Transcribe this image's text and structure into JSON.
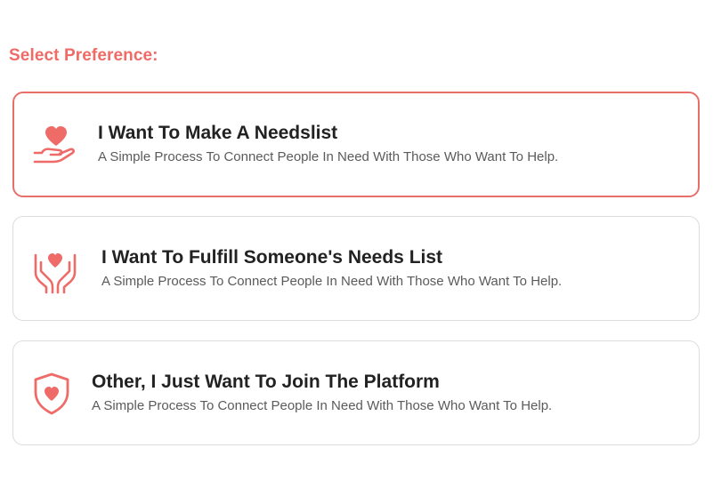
{
  "heading": "Select Preference:",
  "colors": {
    "accent": "#ee6b67",
    "selected_border": "#e86e6a",
    "card_border": "#dcdcdc"
  },
  "options": [
    {
      "title": "I Want To Make A Needslist",
      "description": "A Simple Process To Connect People In Need With Those Who Want To Help.",
      "icon": "heart-in-hand-icon",
      "selected": true
    },
    {
      "title": "I Want To Fulfill Someone's Needs List",
      "description": "A Simple Process To Connect People In Need With Those Who Want To Help.",
      "icon": "heart-in-two-hands-icon",
      "selected": false
    },
    {
      "title": "Other, I Just Want To Join The Platform",
      "description": "A Simple Process To Connect People In Need With Those Who Want To Help.",
      "icon": "heart-shield-icon",
      "selected": false
    }
  ]
}
